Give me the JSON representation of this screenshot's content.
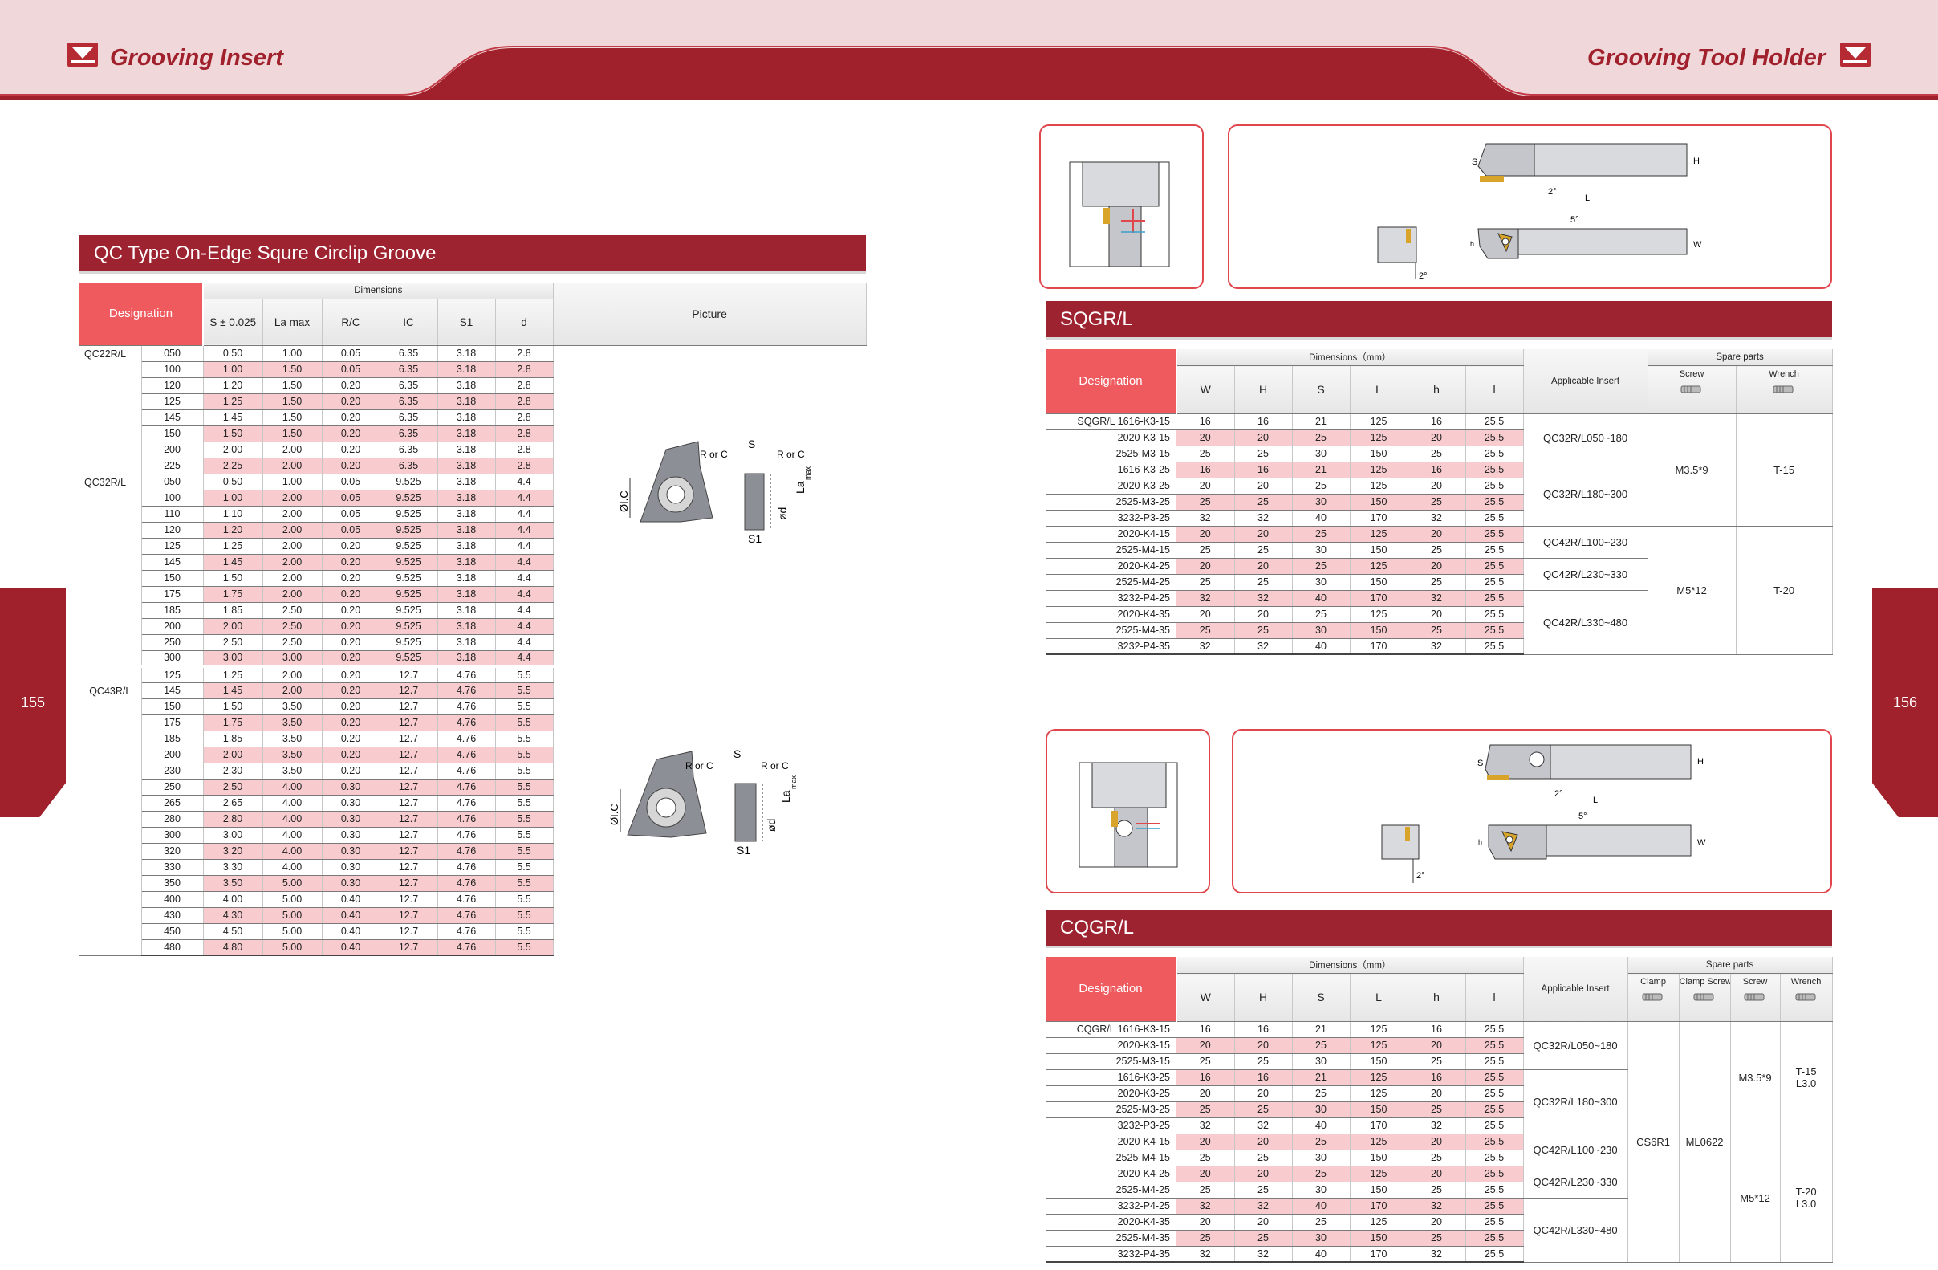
{
  "header": {
    "left_title": "Grooving Insert",
    "right_title": "Grooving Tool Holder"
  },
  "page_numbers": {
    "left": "155",
    "right": "156"
  },
  "colors": {
    "brand_red": "#a0212c",
    "header_pink": "#f0d8da",
    "head_cell": "#ef5a5f",
    "row_pink": "#f8cccf"
  },
  "qc": {
    "title": "QC Type On-Edge Squre Circlip Groove",
    "head_designation": "Designation",
    "head_dimensions": "Dimensions",
    "head_picture": "Picture",
    "cols": [
      "S ± 0.025",
      "La max",
      "R/C",
      "IC",
      "S1",
      "d"
    ],
    "groups": [
      {
        "name": "QC22R/L",
        "rows": [
          [
            "050",
            "0.50",
            "1.00",
            "0.05",
            "6.35",
            "3.18",
            "2.8"
          ],
          [
            "100",
            "1.00",
            "1.50",
            "0.05",
            "6.35",
            "3.18",
            "2.8"
          ],
          [
            "120",
            "1.20",
            "1.50",
            "0.20",
            "6.35",
            "3.18",
            "2.8"
          ],
          [
            "125",
            "1.25",
            "1.50",
            "0.20",
            "6.35",
            "3.18",
            "2.8"
          ],
          [
            "145",
            "1.45",
            "1.50",
            "0.20",
            "6.35",
            "3.18",
            "2.8"
          ],
          [
            "150",
            "1.50",
            "1.50",
            "0.20",
            "6.35",
            "3.18",
            "2.8"
          ],
          [
            "200",
            "2.00",
            "2.00",
            "0.20",
            "6.35",
            "3.18",
            "2.8"
          ],
          [
            "225",
            "2.25",
            "2.00",
            "0.20",
            "6.35",
            "3.18",
            "2.8"
          ]
        ]
      },
      {
        "name": "QC32R/L",
        "rows": [
          [
            "050",
            "0.50",
            "1.00",
            "0.05",
            "9.525",
            "3.18",
            "4.4"
          ],
          [
            "100",
            "1.00",
            "2.00",
            "0.05",
            "9.525",
            "3.18",
            "4.4"
          ],
          [
            "110",
            "1.10",
            "2.00",
            "0.05",
            "9.525",
            "3.18",
            "4.4"
          ],
          [
            "120",
            "1.20",
            "2.00",
            "0.05",
            "9.525",
            "3.18",
            "4.4"
          ],
          [
            "125",
            "1.25",
            "2.00",
            "0.20",
            "9.525",
            "3.18",
            "4.4"
          ],
          [
            "145",
            "1.45",
            "2.00",
            "0.20",
            "9.525",
            "3.18",
            "4.4"
          ],
          [
            "150",
            "1.50",
            "2.00",
            "0.20",
            "9.525",
            "3.18",
            "4.4"
          ],
          [
            "175",
            "1.75",
            "2.00",
            "0.20",
            "9.525",
            "3.18",
            "4.4"
          ],
          [
            "185",
            "1.85",
            "2.50",
            "0.20",
            "9.525",
            "3.18",
            "4.4"
          ],
          [
            "200",
            "2.00",
            "2.50",
            "0.20",
            "9.525",
            "3.18",
            "4.4"
          ],
          [
            "250",
            "2.50",
            "2.50",
            "0.20",
            "9.525",
            "3.18",
            "4.4"
          ],
          [
            "300",
            "3.00",
            "3.00",
            "0.20",
            "9.525",
            "3.18",
            "4.4"
          ]
        ]
      },
      {
        "name": "QC43R/L",
        "rows": [
          [
            "125",
            "1.25",
            "2.00",
            "0.20",
            "12.7",
            "4.76",
            "5.5"
          ],
          [
            "145",
            "1.45",
            "2.00",
            "0.20",
            "12.7",
            "4.76",
            "5.5"
          ],
          [
            "150",
            "1.50",
            "3.50",
            "0.20",
            "12.7",
            "4.76",
            "5.5"
          ],
          [
            "175",
            "1.75",
            "3.50",
            "0.20",
            "12.7",
            "4.76",
            "5.5"
          ],
          [
            "185",
            "1.85",
            "3.50",
            "0.20",
            "12.7",
            "4.76",
            "5.5"
          ],
          [
            "200",
            "2.00",
            "3.50",
            "0.20",
            "12.7",
            "4.76",
            "5.5"
          ],
          [
            "230",
            "2.30",
            "3.50",
            "0.20",
            "12.7",
            "4.76",
            "5.5"
          ],
          [
            "250",
            "2.50",
            "4.00",
            "0.30",
            "12.7",
            "4.76",
            "5.5"
          ],
          [
            "265",
            "2.65",
            "4.00",
            "0.30",
            "12.7",
            "4.76",
            "5.5"
          ],
          [
            "280",
            "2.80",
            "4.00",
            "0.30",
            "12.7",
            "4.76",
            "5.5"
          ],
          [
            "300",
            "3.00",
            "4.00",
            "0.30",
            "12.7",
            "4.76",
            "5.5"
          ],
          [
            "320",
            "3.20",
            "4.00",
            "0.30",
            "12.7",
            "4.76",
            "5.5"
          ],
          [
            "330",
            "3.30",
            "4.00",
            "0.30",
            "12.7",
            "4.76",
            "5.5"
          ],
          [
            "350",
            "3.50",
            "5.00",
            "0.30",
            "12.7",
            "4.76",
            "5.5"
          ],
          [
            "400",
            "4.00",
            "5.00",
            "0.40",
            "12.7",
            "4.76",
            "5.5"
          ],
          [
            "430",
            "4.30",
            "5.00",
            "0.40",
            "12.7",
            "4.76",
            "5.5"
          ],
          [
            "450",
            "4.50",
            "5.00",
            "0.40",
            "12.7",
            "4.76",
            "5.5"
          ],
          [
            "480",
            "4.80",
            "5.00",
            "0.40",
            "12.7",
            "4.76",
            "5.5"
          ]
        ]
      }
    ],
    "picture_labels": {
      "s": "S",
      "rc1": "R or C",
      "rc2": "R or C",
      "la": "La",
      "la_sub": "max",
      "ic": "ØI.C",
      "d": "ød",
      "s1": "S1"
    }
  },
  "sqgr": {
    "title": "SQGR/L",
    "head_designation": "Designation",
    "head_dimensions": "Dimensions（mm）",
    "head_insert": "Applicable Insert",
    "head_spare": "Spare parts",
    "cols": [
      "W",
      "H",
      "S",
      "L",
      "h",
      "l"
    ],
    "spare_cols": [
      "Screw",
      "Wrench"
    ],
    "rows": [
      [
        "SQGR/L  1616-K3-15",
        "16",
        "16",
        "21",
        "125",
        "16",
        "25.5"
      ],
      [
        "2020-K3-15",
        "20",
        "20",
        "25",
        "125",
        "20",
        "25.5"
      ],
      [
        "2525-M3-15",
        "25",
        "25",
        "30",
        "150",
        "25",
        "25.5"
      ],
      [
        "1616-K3-25",
        "16",
        "16",
        "21",
        "125",
        "16",
        "25.5"
      ],
      [
        "2020-K3-25",
        "20",
        "20",
        "25",
        "125",
        "20",
        "25.5"
      ],
      [
        "2525-M3-25",
        "25",
        "25",
        "30",
        "150",
        "25",
        "25.5"
      ],
      [
        "3232-P3-25",
        "32",
        "32",
        "40",
        "170",
        "32",
        "25.5"
      ],
      [
        "2020-K4-15",
        "20",
        "20",
        "25",
        "125",
        "20",
        "25.5"
      ],
      [
        "2525-M4-15",
        "25",
        "25",
        "30",
        "150",
        "25",
        "25.5"
      ],
      [
        "2020-K4-25",
        "20",
        "20",
        "25",
        "125",
        "20",
        "25.5"
      ],
      [
        "2525-M4-25",
        "25",
        "25",
        "30",
        "150",
        "25",
        "25.5"
      ],
      [
        "3232-P4-25",
        "32",
        "32",
        "40",
        "170",
        "32",
        "25.5"
      ],
      [
        "2020-K4-35",
        "20",
        "20",
        "25",
        "125",
        "20",
        "25.5"
      ],
      [
        "2525-M4-35",
        "25",
        "25",
        "30",
        "150",
        "25",
        "25.5"
      ],
      [
        "3232-P4-35",
        "32",
        "32",
        "40",
        "170",
        "32",
        "25.5"
      ]
    ],
    "inserts": [
      "QC32R/L050~180",
      "QC32R/L180~300",
      "QC42R/L100~230",
      "QC42R/L230~330",
      "QC42R/L330~480"
    ],
    "screws": [
      "M3.5*9",
      "M5*12"
    ],
    "wrenches": [
      "T-15",
      "T-20"
    ],
    "drawing_labels": {
      "s": "S",
      "h": "H",
      "l": "L",
      "angle1": "2°",
      "angle2": "5°",
      "angle3": "2°",
      "w": "W",
      "hh": "h"
    }
  },
  "cqgr": {
    "title": "CQGR/L",
    "head_designation": "Designation",
    "head_dimensions": "Dimensions（mm）",
    "head_insert": "Applicable Insert",
    "head_spare": "Spare parts",
    "cols": [
      "W",
      "H",
      "S",
      "L",
      "h",
      "l"
    ],
    "spare_cols": [
      "Clamp",
      "Clamp Screw",
      "Screw",
      "Wrench"
    ],
    "rows": [
      [
        "CQGR/L  1616-K3-15",
        "16",
        "16",
        "21",
        "125",
        "16",
        "25.5"
      ],
      [
        "2020-K3-15",
        "20",
        "20",
        "25",
        "125",
        "20",
        "25.5"
      ],
      [
        "2525-M3-15",
        "25",
        "25",
        "30",
        "150",
        "25",
        "25.5"
      ],
      [
        "1616-K3-25",
        "16",
        "16",
        "21",
        "125",
        "16",
        "25.5"
      ],
      [
        "2020-K3-25",
        "20",
        "20",
        "25",
        "125",
        "20",
        "25.5"
      ],
      [
        "2525-M3-25",
        "25",
        "25",
        "30",
        "150",
        "25",
        "25.5"
      ],
      [
        "3232-P3-25",
        "32",
        "32",
        "40",
        "170",
        "32",
        "25.5"
      ],
      [
        "2020-K4-15",
        "20",
        "20",
        "25",
        "125",
        "20",
        "25.5"
      ],
      [
        "2525-M4-15",
        "25",
        "25",
        "30",
        "150",
        "25",
        "25.5"
      ],
      [
        "2020-K4-25",
        "20",
        "20",
        "25",
        "125",
        "20",
        "25.5"
      ],
      [
        "2525-M4-25",
        "25",
        "25",
        "30",
        "150",
        "25",
        "25.5"
      ],
      [
        "3232-P4-25",
        "32",
        "32",
        "40",
        "170",
        "32",
        "25.5"
      ],
      [
        "2020-K4-35",
        "20",
        "20",
        "25",
        "125",
        "20",
        "25.5"
      ],
      [
        "2525-M4-35",
        "25",
        "25",
        "30",
        "150",
        "25",
        "25.5"
      ],
      [
        "3232-P4-35",
        "32",
        "32",
        "40",
        "170",
        "32",
        "25.5"
      ]
    ],
    "inserts": [
      "QC32R/L050~180",
      "QC32R/L180~300",
      "QC42R/L100~230",
      "QC42R/L230~330",
      "QC42R/L330~480"
    ],
    "clamp": "CS6R1",
    "clamp_screw": "ML0622",
    "screws": [
      "M3.5*9",
      "M5*12"
    ],
    "wrenches": [
      "T-15\nL3.0",
      "T-20\nL3.0"
    ],
    "drawing_labels": {
      "s": "S",
      "h": "H",
      "l": "L",
      "angle1": "2°",
      "angle2": "5°",
      "angle3": "2°",
      "w": "W",
      "hh": "h"
    }
  }
}
